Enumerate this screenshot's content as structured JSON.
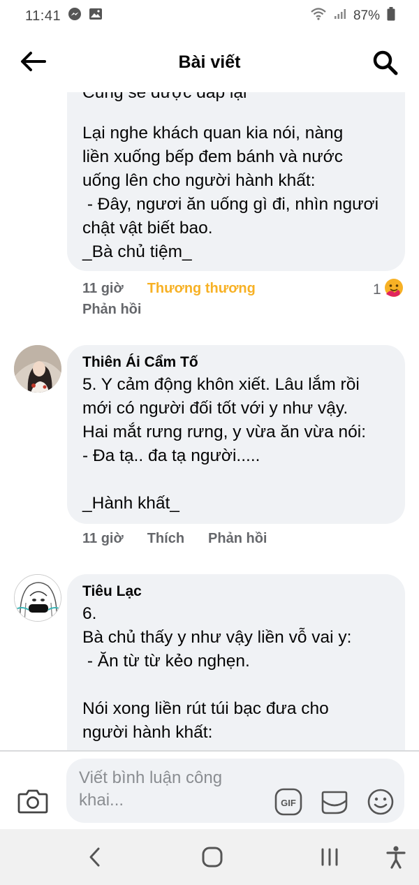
{
  "status_bar": {
    "time": "11:41",
    "battery": "87%"
  },
  "header": {
    "title": "Bài viết"
  },
  "comments": [
    {
      "text": "Lại nghe khách quan kia nói, nàng\nliền xuống bếp đem bánh và nước\nuống lên cho người hành khất:\n - Đây, ngươi ăn uống gì đi, nhìn ngươi\nchật vật biết bao.\n_Bà chủ tiệm_",
      "time": "11 giờ",
      "reaction_label": "Thương thương",
      "reaction_count": "1",
      "reply": "Phản hồi"
    },
    {
      "author": "Thiên Ái Cẩm Tố",
      "text": "5. Y cảm động khôn xiết. Lâu lắm rồi\nmới có người đối tốt với y như vậy.\nHai mắt rưng rưng, y vừa ăn vừa nói:\n- Đa tạ.. đa tạ người.....\n\n_Hành khất_",
      "time": "11 giờ",
      "like": "Thích",
      "reply": "Phản hồi"
    },
    {
      "author": "Tiêu Lạc",
      "text": "6.\nBà chủ thấy y như vậy liền vỗ vai y:\n - Ăn từ từ kẻo nghẹn.\n\nNói xong liền rút túi bạc đưa cho\nngười hành khất:"
    }
  ],
  "composer": {
    "placeholder": "Viết bình luận công khai...",
    "gif_label": "GIF"
  },
  "colors": {
    "bubble": "#f0f2f5",
    "secondary_text": "#65676b",
    "reaction": "#f7b125"
  }
}
